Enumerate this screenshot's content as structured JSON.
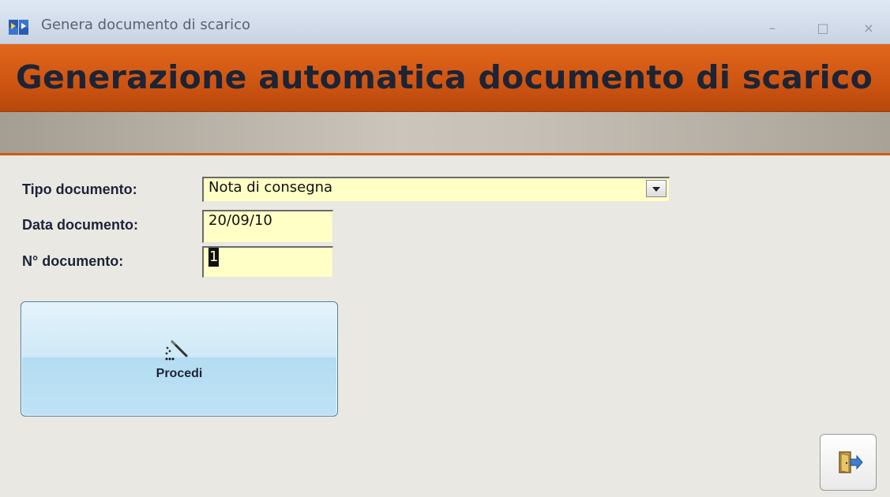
{
  "window": {
    "title": "Genera documento di scarico",
    "minimize_glyph": "–",
    "maximize_glyph": "□",
    "close_glyph": "×",
    "app_icon": "app-icon"
  },
  "banner": {
    "title": "Generazione automatica documento di scarico",
    "color": "#cf5612"
  },
  "form": {
    "tipo_documento": {
      "label": "Tipo documento:",
      "value": "Nota di consegna"
    },
    "data_documento": {
      "label": "Data documento:",
      "value": "20/09/10"
    },
    "numero_documento": {
      "label": "N° documento:",
      "value": "1"
    },
    "field_background": "#ffffc6"
  },
  "actions": {
    "procedi": {
      "label": "Procedi",
      "icon": "magic-wand-icon"
    },
    "exit": {
      "icon": "exit-door-icon"
    }
  }
}
